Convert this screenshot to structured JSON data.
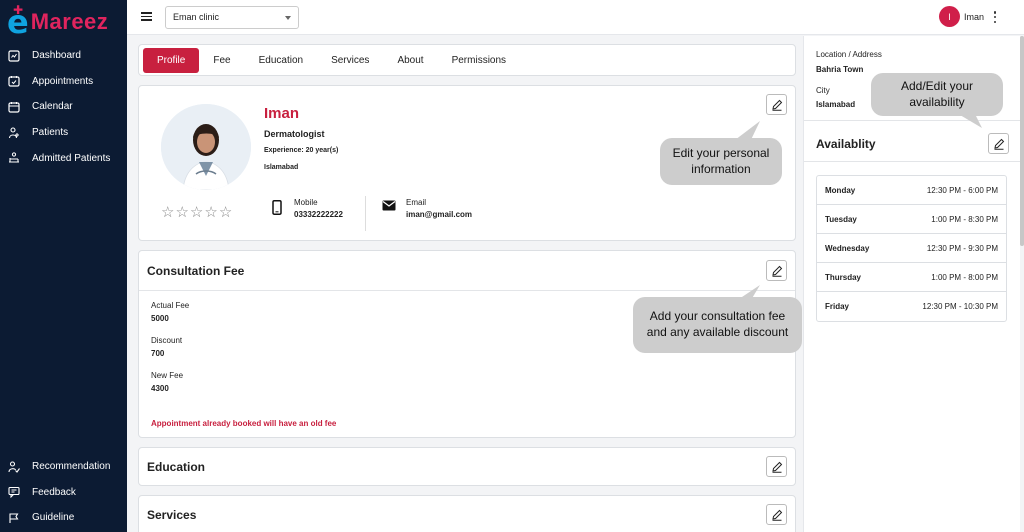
{
  "brand": {
    "logo_letter": "e",
    "logo_text": "Mareez"
  },
  "sidebar": {
    "top_items": [
      {
        "label": "Dashboard",
        "icon": "dashboard-icon"
      },
      {
        "label": "Appointments",
        "icon": "appointments-icon"
      },
      {
        "label": "Calendar",
        "icon": "calendar-icon"
      },
      {
        "label": "Patients",
        "icon": "patients-icon"
      },
      {
        "label": "Admitted Patients",
        "icon": "admitted-icon"
      }
    ],
    "bottom_items": [
      {
        "label": "Recommendation",
        "icon": "recommendation-icon"
      },
      {
        "label": "Feedback",
        "icon": "feedback-icon"
      },
      {
        "label": "Guideline",
        "icon": "flag-icon"
      }
    ]
  },
  "topbar": {
    "clinic": "Eman clinic",
    "user_initial": "I",
    "user_name": "Iman"
  },
  "tabs": [
    "Profile",
    "Fee",
    "Education",
    "Services",
    "About",
    "Permissions"
  ],
  "profile": {
    "name": "Iman",
    "specialty": "Dermatologist",
    "experience": "Experience: 20 year(s)",
    "city": "Islamabad",
    "rating": 0,
    "mobile_label": "Mobile",
    "mobile": "03332222222",
    "email_label": "Email",
    "email": "iman@gmail.com"
  },
  "fee": {
    "title": "Consultation Fee",
    "actual_label": "Actual Fee",
    "actual": "5000",
    "discount_label": "Discount",
    "discount": "700",
    "new_label": "New Fee",
    "new": "4300",
    "note": "Appointment already booked will have an old fee"
  },
  "education": {
    "title": "Education"
  },
  "services": {
    "title": "Services"
  },
  "location": {
    "address_label": "Location / Address",
    "address": "Bahria Town",
    "city_label": "City",
    "city": "Islamabad"
  },
  "availability": {
    "title": "Availablity",
    "days": [
      {
        "day": "Monday",
        "time": "12:30 PM - 6:00 PM"
      },
      {
        "day": "Tuesday",
        "time": "1:00 PM - 8:30 PM"
      },
      {
        "day": "Wednesday",
        "time": "12:30 PM - 9:30 PM"
      },
      {
        "day": "Thursday",
        "time": "1:00 PM - 8:00 PM"
      },
      {
        "day": "Friday",
        "time": "12:30 PM - 10:30 PM"
      }
    ]
  },
  "tooltips": {
    "personal_1": "Edit your personal",
    "personal_2": "information",
    "fee_1": "Add your consultation fee",
    "fee_2": "and any available discount",
    "avail_1": "Add/Edit your",
    "avail_2": "availability"
  },
  "colors": {
    "sidebar": "#0c1b33",
    "accent": "#c8203f",
    "brand_blue": "#0fa3e0",
    "tooltip": "#cdcdcd"
  }
}
